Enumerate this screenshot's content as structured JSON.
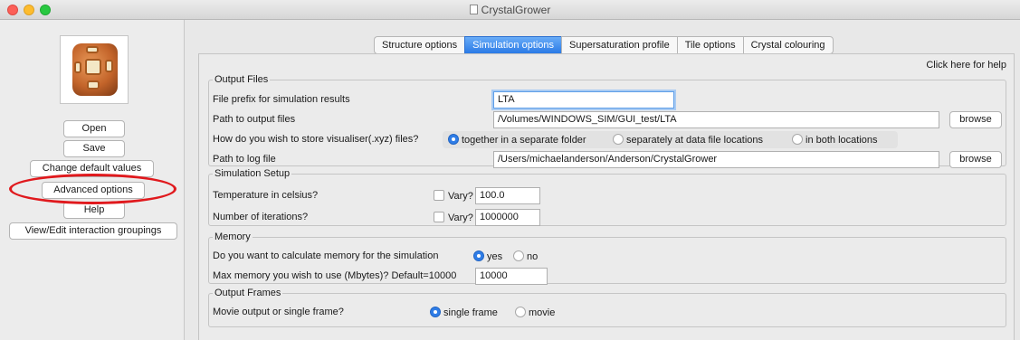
{
  "window": {
    "title": "CrystalGrower"
  },
  "sidebar": {
    "buttons": {
      "open": "Open",
      "save": "Save",
      "change_defaults": "Change default values",
      "advanced": "Advanced options",
      "help": "Help",
      "interaction_groupings": "View/Edit interaction groupings"
    },
    "annotation_color": "#e0191d"
  },
  "tabs": [
    {
      "label": "Structure options",
      "active": false
    },
    {
      "label": "Simulation options",
      "active": true
    },
    {
      "label": "Supersaturation profile",
      "active": false
    },
    {
      "label": "Tile options",
      "active": false
    },
    {
      "label": "Crystal colouring",
      "active": false
    }
  ],
  "help_link": "Click here for help",
  "output_files": {
    "legend": "Output Files",
    "prefix_label": "File prefix for simulation results",
    "prefix_value": "LTA",
    "output_path_label": "Path to output files",
    "output_path_value": "/Volumes/WINDOWS_SIM/GUI_test/LTA",
    "browse_label": "browse",
    "store_label": "How do you wish to store visualiser(.xyz) files?",
    "store_options": [
      "together in a separate folder",
      "separately at data file locations",
      "in both locations"
    ],
    "store_selected": "together in a separate folder",
    "log_path_label": "Path to log file",
    "log_path_value": "/Users/michaelanderson/Anderson/CrystalGrower"
  },
  "simulation_setup": {
    "legend": "Simulation Setup",
    "temperature_label": "Temperature in celsius?",
    "temperature_vary": "Vary?",
    "temperature_value": "100.0",
    "iterations_label": "Number of iterations?",
    "iterations_vary": "Vary?",
    "iterations_value": "1000000"
  },
  "memory": {
    "legend": "Memory",
    "calc_label": "Do you want to calculate memory for the simulation",
    "calc_options": [
      "yes",
      "no"
    ],
    "calc_selected": "yes",
    "max_label": "Max memory you wish to use (Mbytes)? Default=10000",
    "max_value": "10000"
  },
  "output_frames": {
    "legend": "Output Frames",
    "movie_label": "Movie output or single frame?",
    "movie_options": [
      "single frame",
      "movie"
    ],
    "movie_selected": "single frame"
  },
  "colors": {
    "accent": "#2f7de7",
    "tab_active": "#2a7ae6",
    "annotation": "#e0191d"
  }
}
